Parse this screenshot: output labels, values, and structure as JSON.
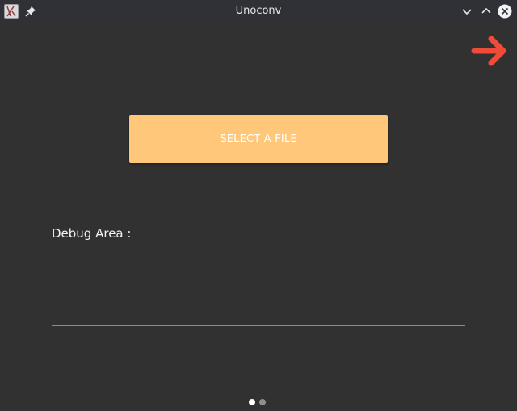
{
  "window": {
    "title": "Unoconv"
  },
  "titlebar": {
    "icons": {
      "app": "app-icon",
      "pin": "pin-icon",
      "minimize": "chevron-down-icon",
      "maximize": "chevron-up-icon",
      "close": "close-icon"
    }
  },
  "navigation": {
    "next_icon": "arrow-right-icon",
    "next_color": "#f04a38"
  },
  "main": {
    "select_button_label": "SELECT A FILE",
    "select_button_color": "#ffc77a",
    "debug_label": "Debug Area :",
    "debug_value": ""
  },
  "pagination": {
    "total_pages": 2,
    "current_page": 1
  },
  "colors": {
    "background": "#313131",
    "titlebar": "#2f3136",
    "text": "#f2f2f2"
  }
}
